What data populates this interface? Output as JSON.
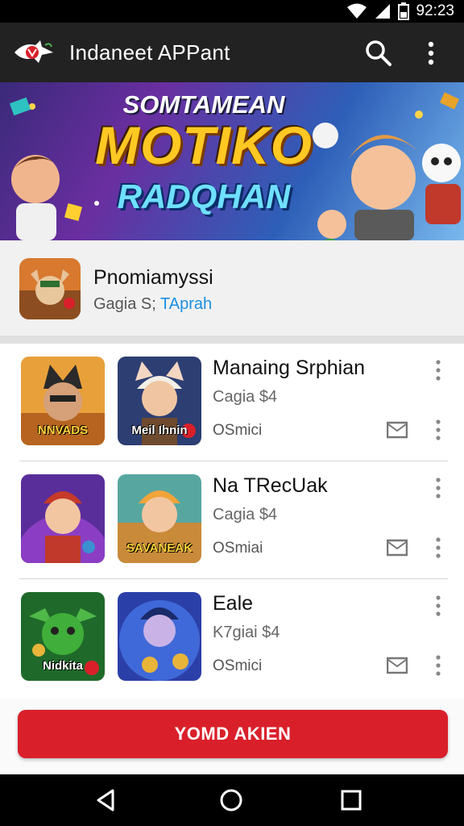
{
  "status_bar": {
    "time": "92:23",
    "icons": [
      "wifi-icon",
      "signal-icon",
      "battery-icon"
    ]
  },
  "app_bar": {
    "title": "Indaneet APPant",
    "icons": [
      "app-logo-icon",
      "search-icon",
      "more-vert-icon"
    ]
  },
  "banner": {
    "line1": "SOMTAMEAN",
    "line2": "MOTIKO",
    "line3": "RADQHAN"
  },
  "featured": {
    "title": "Pnomiamyssi",
    "price": "Gagia S;",
    "link": "TAprah"
  },
  "items": [
    {
      "thumb_a_label": "NNVADS",
      "thumb_b_label": "Meil Ihnin",
      "title": "Manaing Srphian",
      "price": "Cagia $4",
      "status": "OSmici"
    },
    {
      "thumb_a_label": "",
      "thumb_b_label": "SAVANEAK",
      "title": "Na TRecUak",
      "price": "Cagia $4",
      "status": "OSmiai"
    },
    {
      "thumb_a_label": "Nidkita",
      "thumb_b_label": "",
      "title": "Eale",
      "price": "K7giai $4",
      "status": "OSmici"
    }
  ],
  "action": {
    "label": "YOMD AKIEN"
  },
  "nav_bar": {
    "icons": [
      "back-icon",
      "home-icon",
      "recents-icon"
    ]
  },
  "colors": {
    "accent": "#d9202a",
    "link": "#1a8fe0",
    "appbar": "#222222"
  }
}
